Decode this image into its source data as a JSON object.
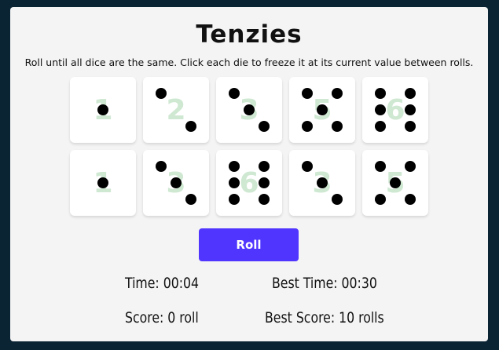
{
  "game": {
    "title": "Tenzies",
    "instructions": "Roll until all dice are the same. Click each die to freeze it at its current value between rolls.",
    "roll_button": "Roll",
    "pip_color": "#000000",
    "die_number_color": "#cfe8d2",
    "button_color": "#5035ff"
  },
  "dice": [
    {
      "label": "1",
      "pips": 1
    },
    {
      "label": "2",
      "pips": 2
    },
    {
      "label": "3",
      "pips": 3
    },
    {
      "label": "5",
      "pips": 5
    },
    {
      "label": "6",
      "pips": 6
    },
    {
      "label": "1",
      "pips": 1
    },
    {
      "label": "3",
      "pips": 3
    },
    {
      "label": "6",
      "pips": 6
    },
    {
      "label": "3",
      "pips": 3
    },
    {
      "label": "5",
      "pips": 5
    }
  ],
  "stats": {
    "time": "Time: 00:04",
    "best_time": "Best Time: 00:30",
    "score": "Score: 0 roll",
    "best_score": "Best Score: 10 rolls"
  }
}
